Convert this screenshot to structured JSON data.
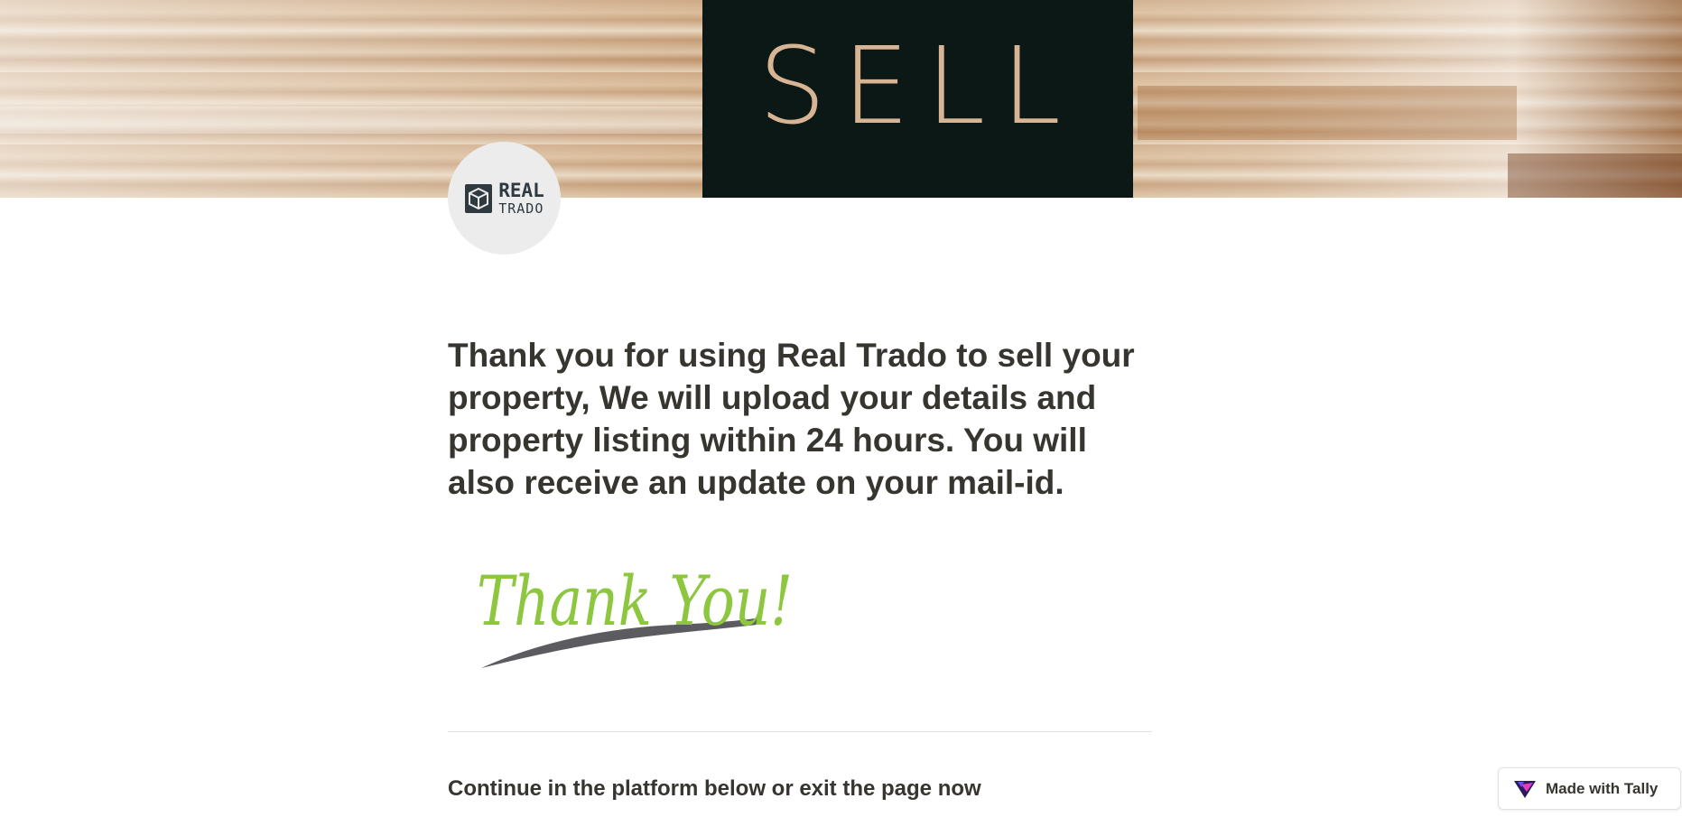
{
  "cover": {
    "sign_text": "SELL"
  },
  "logo": {
    "line1": "REAL",
    "line2": "TRADO"
  },
  "form": {
    "heading": "Thank you for using Real Trado to sell your property, We will upload your details and property listing within 24 hours. You will also receive an update on your mail-id.",
    "thank_you_image_text": "Thank You!",
    "continue_text": "Continue in the platform below or exit the page now"
  },
  "badge": {
    "label": "Made with Tally",
    "icon": "tally-logo-icon"
  },
  "colors": {
    "text": "#37352f",
    "thank_you_green": "#8dc63f",
    "brush_gray": "#4a4a4f",
    "sign_background": "#0c1816",
    "logo_background": "#ececec"
  }
}
